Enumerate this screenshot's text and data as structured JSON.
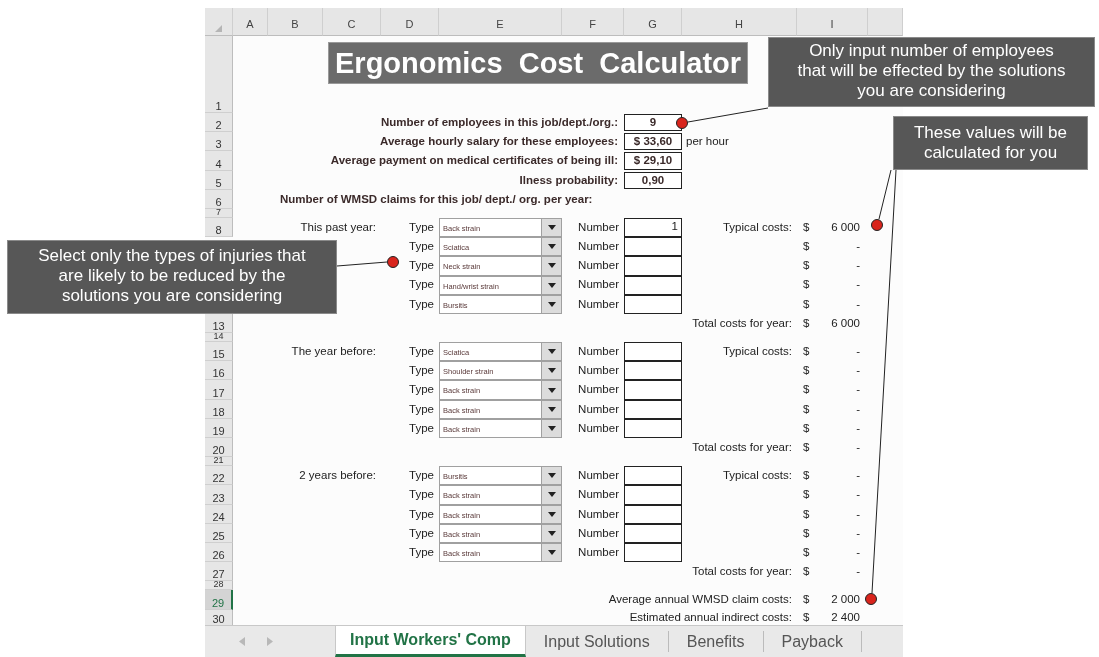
{
  "sheet": {
    "column_headers": [
      "A",
      "B",
      "C",
      "D",
      "E",
      "F",
      "G",
      "H",
      "I"
    ],
    "row_headers": [
      {
        "label": "1",
        "kind": "row",
        "selected": false
      },
      {
        "label": "2",
        "kind": "row",
        "selected": false
      },
      {
        "label": "3",
        "kind": "row",
        "selected": false
      },
      {
        "label": "4",
        "kind": "row",
        "selected": false
      },
      {
        "label": "5",
        "kind": "row",
        "selected": false
      },
      {
        "label": "6",
        "kind": "row",
        "selected": false
      },
      {
        "label": "7",
        "kind": "spacer",
        "selected": false
      },
      {
        "label": "8",
        "kind": "row",
        "selected": false
      },
      {
        "label": "13",
        "kind": "row",
        "selected": false
      },
      {
        "label": "14",
        "kind": "spacer",
        "selected": false
      },
      {
        "label": "15",
        "kind": "row",
        "selected": false
      },
      {
        "label": "16",
        "kind": "row",
        "selected": false
      },
      {
        "label": "17",
        "kind": "row",
        "selected": false
      },
      {
        "label": "18",
        "kind": "row",
        "selected": false
      },
      {
        "label": "19",
        "kind": "row",
        "selected": false
      },
      {
        "label": "20",
        "kind": "row",
        "selected": false
      },
      {
        "label": "21",
        "kind": "spacer",
        "selected": false
      },
      {
        "label": "22",
        "kind": "row",
        "selected": false
      },
      {
        "label": "23",
        "kind": "row",
        "selected": false
      },
      {
        "label": "24",
        "kind": "row",
        "selected": false
      },
      {
        "label": "25",
        "kind": "row",
        "selected": false
      },
      {
        "label": "26",
        "kind": "row",
        "selected": false
      },
      {
        "label": "27",
        "kind": "row",
        "selected": false
      },
      {
        "label": "28",
        "kind": "spacer",
        "selected": false
      },
      {
        "label": "29",
        "kind": "row",
        "selected": true
      },
      {
        "label": "30",
        "kind": "row",
        "selected": false
      }
    ],
    "title": "Ergonomics  Cost  Calculator",
    "inputs": [
      {
        "label": "Number of employees in this job/dept./org.:",
        "value": "9"
      },
      {
        "label": "Average hourly salary for these employees:",
        "value": "$  33,60",
        "suffix": "per hour"
      },
      {
        "label": "Average payment on medical certificates of being ill:",
        "value": "$  29,10"
      },
      {
        "label": "Ilness probability:",
        "value": "0,90"
      }
    ],
    "claims_heading": "Number of WMSD claims for this job/ dept./ org. per year:",
    "years": [
      {
        "label": "This past year:",
        "typical_label": "Typical costs:",
        "total_label": "Total costs for year:",
        "total_currency": "$",
        "total": "6 000",
        "entries": [
          {
            "type_label": "Type",
            "injury": "Back strain",
            "number_label": "Number",
            "number": "1",
            "currency": "$",
            "cost": "6 000"
          },
          {
            "type_label": "Type",
            "injury": "Sciatica",
            "number_label": "Number",
            "currency": "$",
            "cost": "-"
          },
          {
            "type_label": "Type",
            "injury": "Neck strain",
            "number_label": "Number",
            "currency": "$",
            "cost": "-"
          },
          {
            "type_label": "Type",
            "injury": "Hand/wrist strain",
            "number_label": "Number",
            "currency": "$",
            "cost": "-"
          },
          {
            "type_label": "Type",
            "injury": "Bursitis",
            "number_label": "Number",
            "currency": "$",
            "cost": "-"
          }
        ]
      },
      {
        "label": "The year before:",
        "typical_label": "Typical costs:",
        "total_label": "Total costs for year:",
        "total_currency": "$",
        "total": "-",
        "entries": [
          {
            "type_label": "Type",
            "injury": "Sciatica",
            "number_label": "Number",
            "currency": "$",
            "cost": "-"
          },
          {
            "type_label": "Type",
            "injury": "Shoulder strain",
            "number_label": "Number",
            "currency": "$",
            "cost": "-"
          },
          {
            "type_label": "Type",
            "injury": "Back strain",
            "number_label": "Number",
            "currency": "$",
            "cost": "-"
          },
          {
            "type_label": "Type",
            "injury": "Back strain",
            "number_label": "Number",
            "currency": "$",
            "cost": "-"
          },
          {
            "type_label": "Type",
            "injury": "Back strain",
            "number_label": "Number",
            "currency": "$",
            "cost": "-"
          }
        ]
      },
      {
        "label": "2 years before:",
        "typical_label": "Typical costs:",
        "total_label": "Total costs for year:",
        "total_currency": "$",
        "total": "-",
        "entries": [
          {
            "type_label": "Type",
            "injury": "Bursitis",
            "number_label": "Number",
            "currency": "$",
            "cost": "-"
          },
          {
            "type_label": "Type",
            "injury": "Back strain",
            "number_label": "Number",
            "currency": "$",
            "cost": "-"
          },
          {
            "type_label": "Type",
            "injury": "Back strain",
            "number_label": "Number",
            "currency": "$",
            "cost": "-"
          },
          {
            "type_label": "Type",
            "injury": "Back strain",
            "number_label": "Number",
            "currency": "$",
            "cost": "-"
          },
          {
            "type_label": "Type",
            "injury": "Back strain",
            "number_label": "Number",
            "currency": "$",
            "cost": "-"
          }
        ]
      }
    ],
    "summary": [
      {
        "label": "Average annual WMSD claim costs:",
        "currency": "$",
        "value": "2 000"
      },
      {
        "label": "Estimated annual indirect costs:",
        "currency": "$",
        "value": "2 400"
      }
    ]
  },
  "sheet_tabs": [
    {
      "label": "Input Workers' Comp",
      "selected": true
    },
    {
      "label": "Input Solutions",
      "selected": false
    },
    {
      "label": "Benefits",
      "selected": false
    },
    {
      "label": "Payback",
      "selected": false
    }
  ],
  "callouts": [
    {
      "text": "Only input number of employees\nthat will be effected by the solutions\nyou are considering"
    },
    {
      "text": "These values will be\ncalculated for you"
    },
    {
      "text": "Select only the types of injuries that\nare likely to be reduced by the\nsolutions you are considering"
    }
  ]
}
